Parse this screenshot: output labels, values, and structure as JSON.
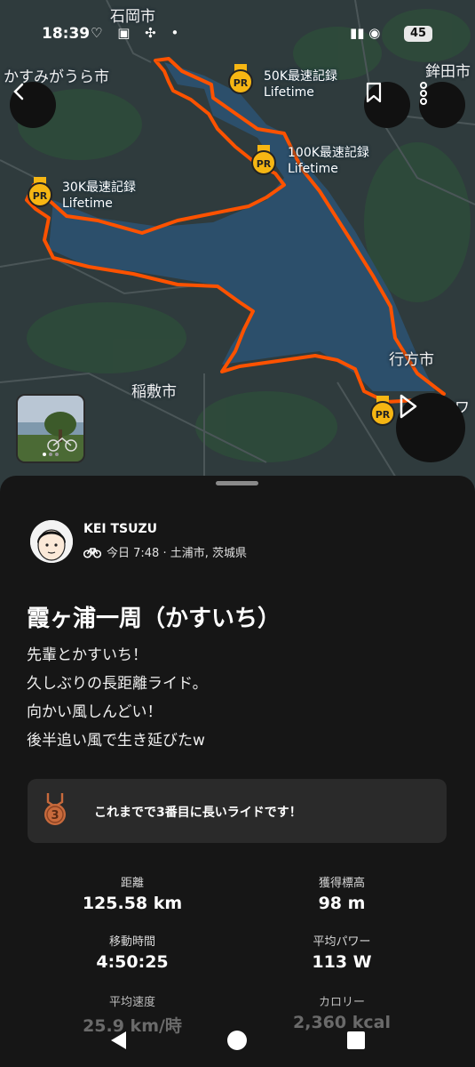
{
  "status_bar": {
    "time": "18:39",
    "battery": "45"
  },
  "map": {
    "places": [
      "石岡市",
      "かすみがうら市",
      "鉾田市",
      "行方市",
      "稲敷市",
      "ワ"
    ],
    "pr_markers": [
      {
        "badge": "PR",
        "title": "50K最速記録",
        "sub": "Lifetime"
      },
      {
        "badge": "PR",
        "title": "100K最速記録",
        "sub": "Lifetime"
      },
      {
        "badge": "PR",
        "title": "30K最速記録",
        "sub": "Lifetime"
      },
      {
        "badge": "PR"
      }
    ]
  },
  "activity": {
    "athlete": "KEI TSUZU",
    "meta": "今日 7:48 · 土浦市, 茨城県",
    "title": "霞ヶ浦一周（かすいち）",
    "description": [
      "先輩とかすいち！",
      "久しぶりの長距離ライド。",
      "向かい風しんどい！",
      "後半追い風で生き延びたw"
    ],
    "achievement": {
      "rank": "3",
      "text": "これまでで3番目に長いライドです！"
    },
    "stats": [
      {
        "label": "距離",
        "value": "125.58 km"
      },
      {
        "label": "獲得標高",
        "value": "98 m"
      },
      {
        "label": "移動時間",
        "value": "4:50:25"
      },
      {
        "label": "平均パワー",
        "value": "113 W"
      },
      {
        "label": "平均速度",
        "value": "25.9 km/時"
      },
      {
        "label": "カロリー",
        "value": "2,360 kcal"
      }
    ]
  },
  "colors": {
    "route": "#fc5200",
    "lake": "#2c4f6b",
    "land": "#2f3b3d",
    "badge": "#f6b613"
  }
}
